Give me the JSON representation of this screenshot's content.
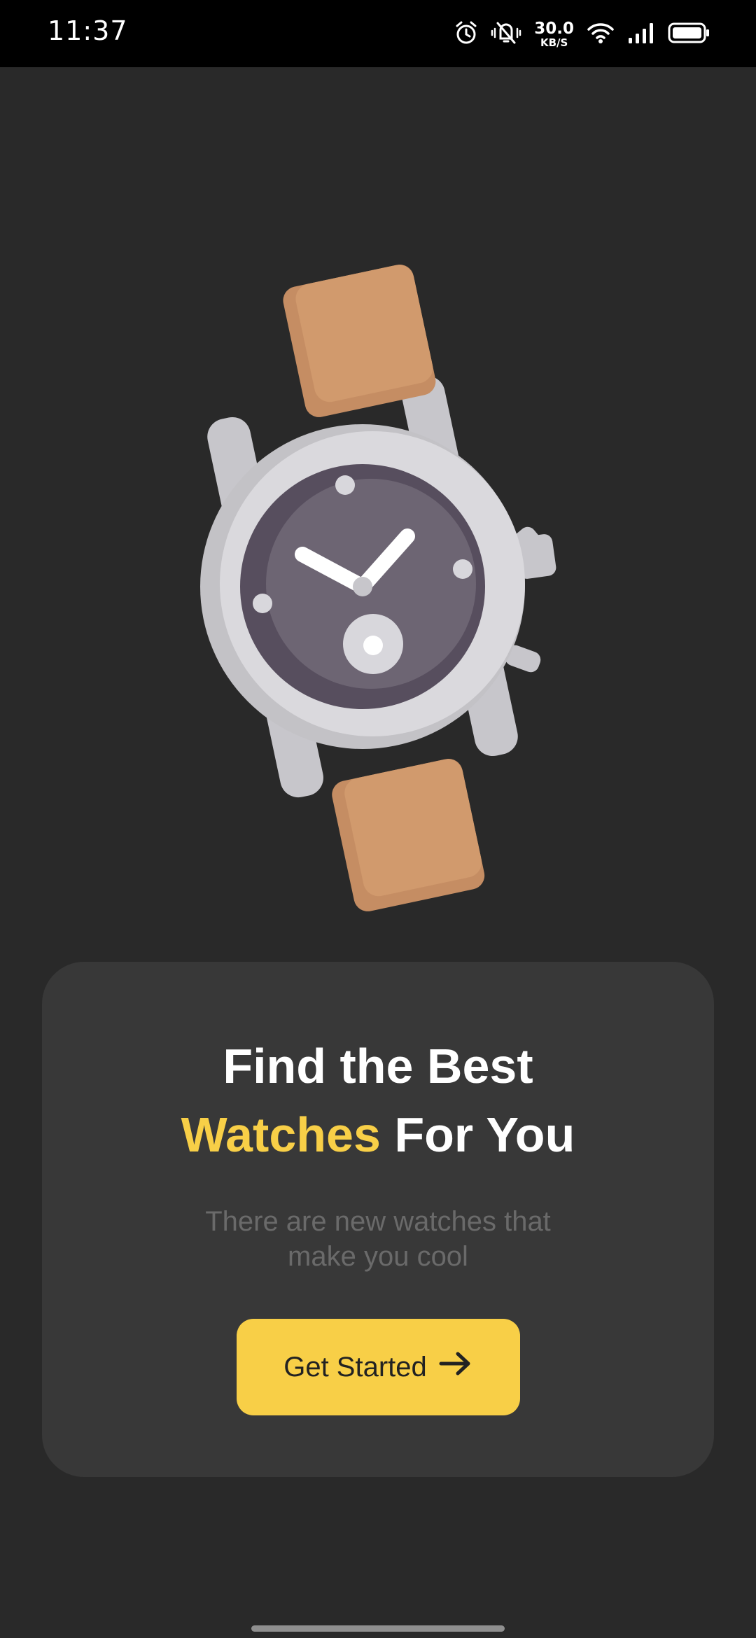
{
  "status_bar": {
    "time": "11:37",
    "net_speed_value": "30.0",
    "net_speed_unit": "KB/S",
    "icons": [
      "alarm-icon",
      "vibrate-off-icon",
      "wifi-icon",
      "signal-icon",
      "battery-icon"
    ]
  },
  "hero": {
    "illustration": "wristwatch-illustration"
  },
  "card": {
    "title_line1": "Find the Best",
    "title_accent": "Watches",
    "title_rest": " For You",
    "subtitle": "There are new watches that make you cool",
    "cta_label": "Get Started",
    "cta_icon": "arrow-right-icon"
  },
  "colors": {
    "background": "#292929",
    "card": "#383838",
    "accent": "#f8cf47",
    "strap": "#d19a6d",
    "case": "#d6d5d9",
    "dial": "#6b6270"
  }
}
